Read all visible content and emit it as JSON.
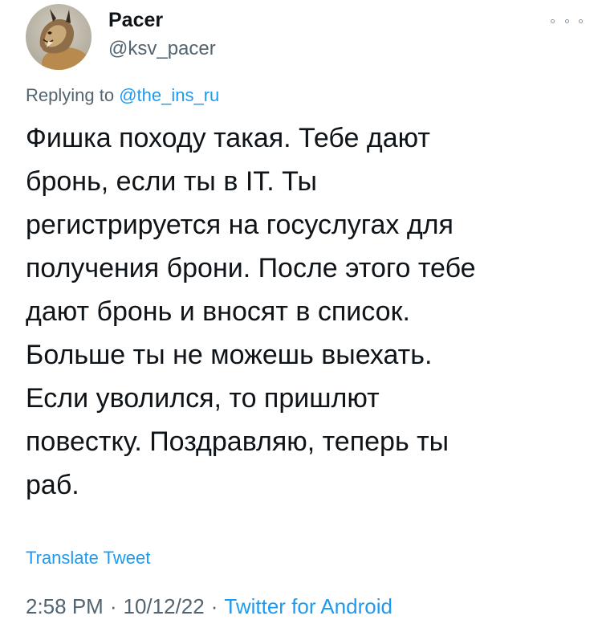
{
  "author": {
    "display_name": "Pacer",
    "handle": "@ksv_pacer",
    "avatar_icon": "lynx-avatar-icon"
  },
  "more_icon": "more-horizontal-icon",
  "reply": {
    "prefix": "Replying to",
    "mention": "@the_ins_ru"
  },
  "tweet": {
    "text": "Фишка походу такая. Тебе дают\nбронь, если ты в IT. Ты\nрегистрируется на госуслугах для\nполучения брони. После этого тебе\nдают бронь и вносят в список.\nБольше ты не можешь выехать.\nЕсли уволился, то пришлют\nповестку. Поздравляю, теперь ты\nраб."
  },
  "translate_label": "Translate Tweet",
  "meta": {
    "time": "2:58 PM",
    "separator": "·",
    "date": "10/12/22",
    "source": "Twitter for Android"
  },
  "colors": {
    "link": "#1d9bf0",
    "secondary_text": "#536471",
    "primary_text": "#0f1419"
  }
}
